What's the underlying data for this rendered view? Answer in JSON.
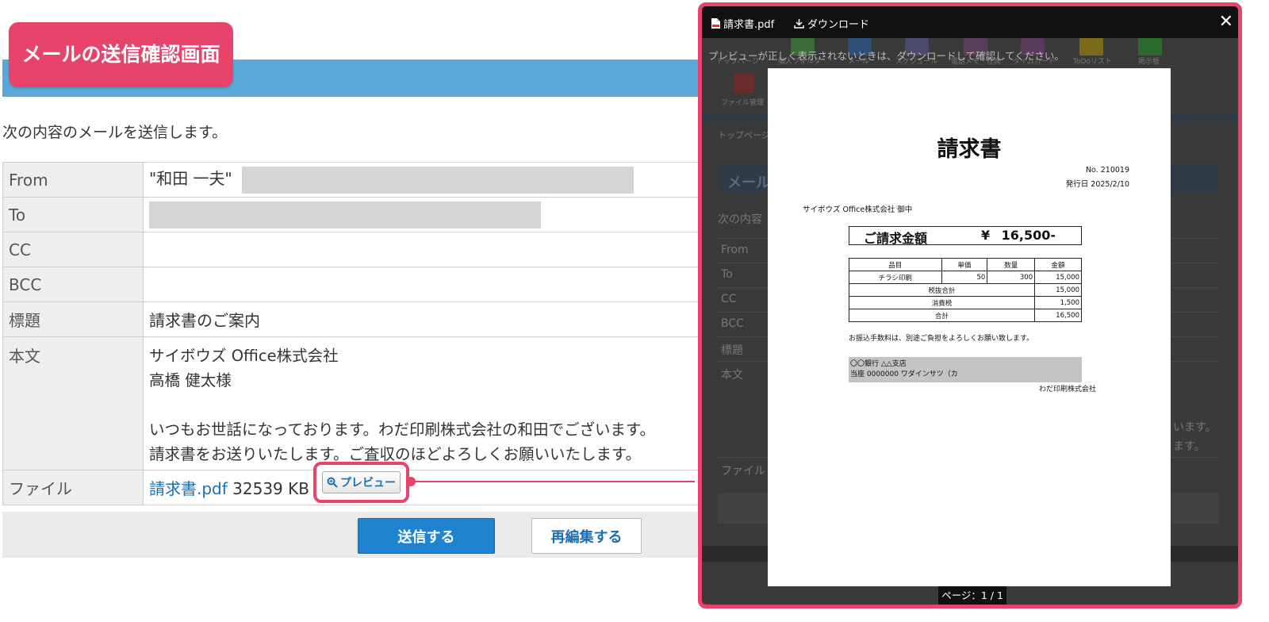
{
  "callout": {
    "label": "メールの送信確認画面"
  },
  "intro": "次の内容のメールを送信します。",
  "mail": {
    "from_label": "From",
    "from_name": "\"和田 一夫\"",
    "to_label": "To",
    "cc_label": "CC",
    "bcc_label": "BCC",
    "subject_label": "標題",
    "subject": "請求書のご案内",
    "body_label": "本文",
    "body_lines": [
      "サイボウズ Office株式会社",
      "高橋 健太様",
      "",
      "いつもお世話になっております。わだ印刷株式会社の和田でございます。",
      "請求書をお送りいたします。ご査収のほどよろしくお願いいたします。"
    ],
    "file_label": "ファイル",
    "file_name": "請求書.pdf",
    "file_size": "32539 KB",
    "preview_button": "プレビュー"
  },
  "actions": {
    "send": "送信する",
    "reedit": "再編集する"
  },
  "modal": {
    "file_name": "請求書.pdf",
    "download": "ダウンロード",
    "notice": "プレビューが正しく表示されないときは、ダウンロードして確認してください。",
    "page_indicator": "ページ：1 / 1",
    "background_labels": {
      "toolbar": [
        "トップページ",
        "個人フォルダ",
        "メール",
        "スケジュール",
        "電話メモ・在席",
        "タイムカード",
        "ToDoリスト",
        "掲示板"
      ],
      "file_mgmt": "ファイル管理",
      "breadcrumb": "トップページ",
      "heading": "メール",
      "intro": "次の内容",
      "rows": [
        "From",
        "To",
        "CC",
        "BCC",
        "標題",
        "本文"
      ],
      "body_tail_1": "います。",
      "body_tail_2": "ます。",
      "file_row": "ファイル"
    }
  },
  "invoice": {
    "title": "請求書",
    "number": "No.  210019",
    "issue_date": "発行日    2025/2/10",
    "recipient": "サイボウズ Office株式会社 御中",
    "amount_label": "ご請求金額",
    "amount_currency": "¥",
    "amount_value": "16,500-",
    "headers": [
      "品目",
      "単価",
      "数量",
      "金額"
    ],
    "item": {
      "name": "チラシ印刷",
      "unit_price": "50",
      "quantity": "300",
      "amount": "15,000"
    },
    "subtotal_label": "税抜合計",
    "subtotal": "15,000",
    "tax_label": "消費税",
    "tax": "1,500",
    "total_label": "合計",
    "total": "16,500",
    "note": "お振込手数料は、別途ご負担をよろしくお願い致します。",
    "bank_line1": "〇〇銀行 △△支店",
    "bank_line2": "当座   0000000  ワダインサツ（カ",
    "issuer": "わだ印刷株式会社"
  },
  "colors": {
    "accent": "#e8436a",
    "header_blue": "#5ba9d8",
    "primary_button": "#1f83cf",
    "link": "#1e6fae"
  }
}
